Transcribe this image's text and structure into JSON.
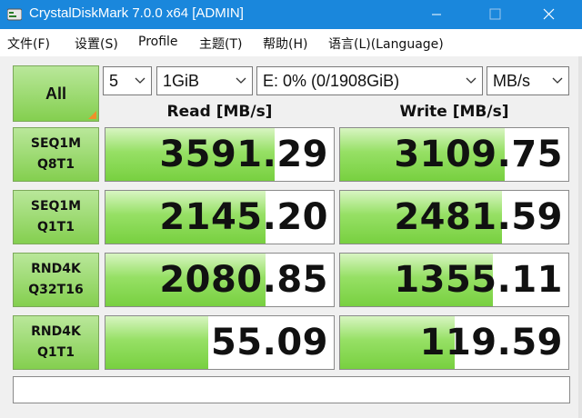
{
  "window": {
    "title": "CrystalDiskMark 7.0.0 x64 [ADMIN]",
    "titlebar_color": "#1a87dc"
  },
  "menu": [
    {
      "label": "文件(F)"
    },
    {
      "label": "设置(S)"
    },
    {
      "label": "Profile"
    },
    {
      "label": "主题(T)"
    },
    {
      "label": "帮助(H)"
    },
    {
      "label": "语言(L)(Language)"
    }
  ],
  "controls": {
    "all_label": "All",
    "count": "5",
    "size": "1GiB",
    "drive": "E: 0% (0/1908GiB)",
    "unit": "MB/s"
  },
  "headers": {
    "read": "Read [MB/s]",
    "write": "Write [MB/s]"
  },
  "tests": [
    {
      "line1": "SEQ1M",
      "line2": "Q8T1",
      "read": "3591.29",
      "write": "3109.75",
      "read_fill": 0.74,
      "write_fill": 0.72
    },
    {
      "line1": "SEQ1M",
      "line2": "Q1T1",
      "read": "2145.20",
      "write": "2481.59",
      "read_fill": 0.7,
      "write_fill": 0.71
    },
    {
      "line1": "RND4K",
      "line2": "Q32T16",
      "read": "2080.85",
      "write": "1355.11",
      "read_fill": 0.7,
      "write_fill": 0.67
    },
    {
      "line1": "RND4K",
      "line2": "Q1T1",
      "read": "55.09",
      "write": "119.59",
      "read_fill": 0.45,
      "write_fill": 0.5
    }
  ],
  "comment": "",
  "colors": {
    "accent_green": "#84cf4f",
    "bar_green": "#78d040",
    "corner_orange": "#f0902a"
  }
}
